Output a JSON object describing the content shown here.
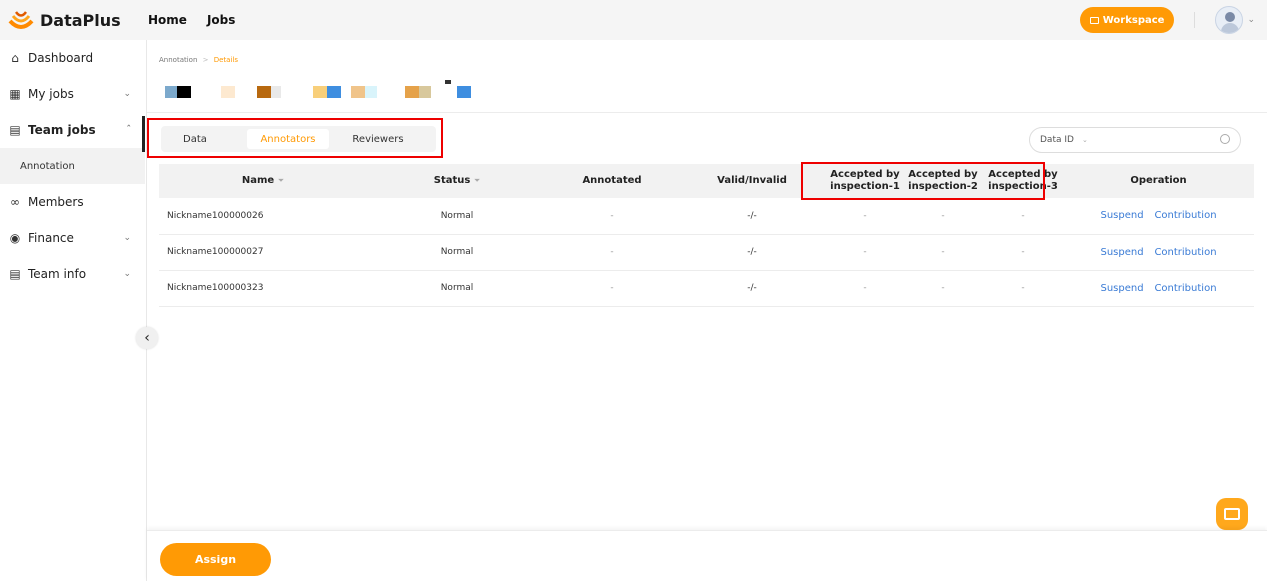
{
  "brand": {
    "name": "DataPlus"
  },
  "nav": {
    "home": "Home",
    "jobs": "Jobs"
  },
  "topbar": {
    "workspace": "Workspace"
  },
  "sidebar": {
    "items": [
      {
        "label": "Dashboard",
        "icon": "home-icon"
      },
      {
        "label": "My jobs",
        "icon": "calendar-icon"
      },
      {
        "label": "Team jobs",
        "icon": "team-jobs-icon"
      },
      {
        "label": "Members",
        "icon": "members-icon"
      },
      {
        "label": "Finance",
        "icon": "finance-icon"
      },
      {
        "label": "Team info",
        "icon": "team-info-icon"
      }
    ],
    "sub_item": "Annotation"
  },
  "breadcrumb": {
    "parent": "Annotation",
    "sep": ">",
    "current": "Details"
  },
  "tabs": [
    "Data",
    "Annotators",
    "Reviewers"
  ],
  "search": {
    "select": "Data ID"
  },
  "table": {
    "headers": [
      "Name",
      "Status",
      "Annotated",
      "Valid/Invalid",
      "Accepted by inspection-1",
      "Accepted by inspection-2",
      "Accepted by inspection-3",
      "Operation"
    ],
    "rows": [
      {
        "name": "Nickname100000026",
        "status": "Normal",
        "annotated": "-",
        "valid": "-/-",
        "a1": "-",
        "a2": "-",
        "a3": "-"
      },
      {
        "name": "Nickname100000027",
        "status": "Normal",
        "annotated": "-",
        "valid": "-/-",
        "a1": "-",
        "a2": "-",
        "a3": "-"
      },
      {
        "name": "Nickname100000323",
        "status": "Normal",
        "annotated": "-",
        "valid": "-/-",
        "a1": "-",
        "a2": "-",
        "a3": "-"
      }
    ],
    "ops": {
      "suspend": "Suspend",
      "contribution": "Contribution"
    }
  },
  "footer": {
    "assign": "Assign"
  },
  "colors": {
    "accent": "#ff9a05",
    "link": "#3a7bd5",
    "highlight": "#e00000"
  }
}
